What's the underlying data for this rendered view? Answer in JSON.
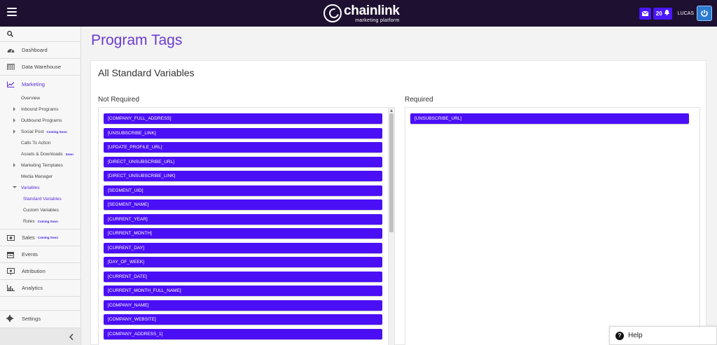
{
  "header": {
    "logo_main": "chainlink",
    "logo_sub": "marketing platform",
    "notifications_count": "20",
    "user_name": "LUCAS",
    "icons": {
      "menu": "hamburger-icon",
      "mail": "mail-icon",
      "bell": "bell-icon",
      "power": "power-icon"
    }
  },
  "sidebar": {
    "dashboard": "Dashboard",
    "data_warehouse": "Data Warehouse",
    "marketing": "Marketing",
    "overview": "Overview",
    "inbound_programs": "Inbound Programs",
    "outbound_programs": "Outbound Programs",
    "social_post": "Social Post",
    "social_post_badge": "Coming Soon",
    "calls_to_action": "Calls To Action",
    "assets_downloads": "Assets & Downloads",
    "assets_badge": "Soon",
    "marketing_templates": "Marketing Templates",
    "media_manager": "Media Manager",
    "variables": "Variables",
    "standard_variables": "Standard Variables",
    "custom_variables": "Custom Variables",
    "rules": "Rules",
    "rules_badge": "Coming Soon",
    "sales": "Sales",
    "sales_badge": "Coming Soon",
    "events": "Events",
    "attribution": "Attribution",
    "analytics": "Analytics",
    "settings": "Settings"
  },
  "main": {
    "page_title": "Program Tags",
    "card_title": "All Standard Variables",
    "not_required_label": "Not Required",
    "required_label": "Required",
    "not_required_tags": [
      "[COMPANY_FULL_ADDRESS]",
      "[UNSUBSCRIBE_LINK]",
      "[UPDATE_PROFILE_URL]",
      "[DIRECT_UNSUBSCRIBE_URL]",
      "[DIRECT_UNSUBSCRIBE_LINK]",
      "[SEGMENT_UID]",
      "[SEGMENT_NAME]",
      "[CURRENT_YEAR]",
      "[CURRENT_MONTH]",
      "[CURRENT_DAY]",
      "[DAY_OF_WEEK]",
      "[CURRENT_DATE]",
      "[CURRENT_MONTH_FULL_NAME]",
      "[COMPANY_NAME]",
      "[COMPANY_WEBSITE]",
      "[COMPANY_ADDRESS_1]"
    ],
    "required_tags": [
      "[UNSUBSCRIBE_URL]"
    ]
  },
  "help": {
    "label": "Help"
  },
  "colors": {
    "tag": "#4b0ff6",
    "accent": "#6b3bd0",
    "topbar": "#1d1030"
  }
}
